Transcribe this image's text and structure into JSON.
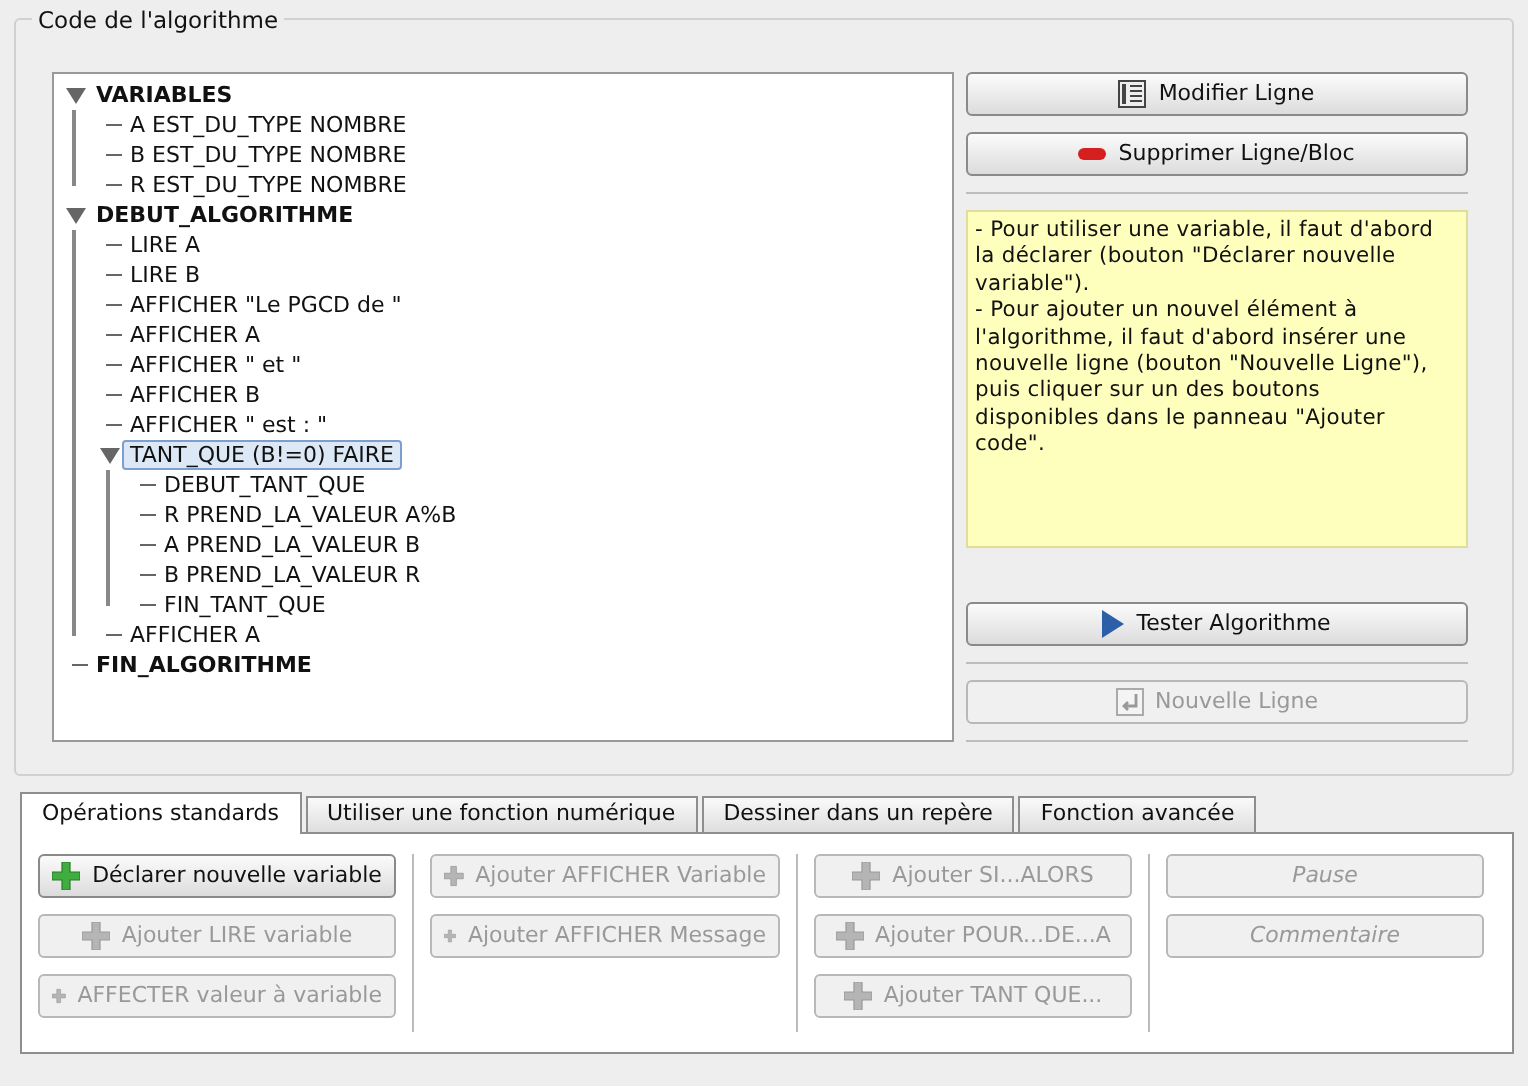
{
  "code_panel": {
    "title": "Code de l'algorithme",
    "tree": [
      {
        "text": "VARIABLES",
        "bold": true,
        "expanded": true,
        "selected": false,
        "children": [
          {
            "text": "A EST_DU_TYPE NOMBRE",
            "bold": false,
            "selected": false
          },
          {
            "text": "B EST_DU_TYPE NOMBRE",
            "bold": false,
            "selected": false
          },
          {
            "text": "R EST_DU_TYPE NOMBRE",
            "bold": false,
            "selected": false
          }
        ]
      },
      {
        "text": "DEBUT_ALGORITHME",
        "bold": true,
        "expanded": true,
        "selected": false,
        "children": [
          {
            "text": "LIRE A",
            "bold": false,
            "selected": false
          },
          {
            "text": "LIRE B",
            "bold": false,
            "selected": false
          },
          {
            "text": "AFFICHER \"Le PGCD de \"",
            "bold": false,
            "selected": false
          },
          {
            "text": "AFFICHER A",
            "bold": false,
            "selected": false
          },
          {
            "text": "AFFICHER \" et \"",
            "bold": false,
            "selected": false
          },
          {
            "text": "AFFICHER B",
            "bold": false,
            "selected": false
          },
          {
            "text": "AFFICHER \" est : \"",
            "bold": false,
            "selected": false
          },
          {
            "text": "TANT_QUE (B!=0) FAIRE",
            "bold": false,
            "expanded": true,
            "selected": true,
            "children": [
              {
                "text": "DEBUT_TANT_QUE",
                "bold": false,
                "selected": false
              },
              {
                "text": "R PREND_LA_VALEUR A%B",
                "bold": false,
                "selected": false
              },
              {
                "text": "A PREND_LA_VALEUR B",
                "bold": false,
                "selected": false
              },
              {
                "text": "B PREND_LA_VALEUR R",
                "bold": false,
                "selected": false
              },
              {
                "text": "FIN_TANT_QUE",
                "bold": false,
                "selected": false
              }
            ]
          },
          {
            "text": "AFFICHER A",
            "bold": false,
            "selected": false
          }
        ]
      },
      {
        "text": "FIN_ALGORITHME",
        "bold": true,
        "selected": false
      }
    ],
    "top_buttons": [
      {
        "label": "Modifier Ligne",
        "kind": "list",
        "disabled": false
      },
      {
        "label": "Supprimer Ligne/Bloc",
        "kind": "minus",
        "disabled": false
      }
    ],
    "help": "- Pour utiliser une variable, il faut d'abord la déclarer (bouton \"Déclarer nouvelle variable\").\n- Pour ajouter un nouvel élément à l'algorithme, il faut d'abord insérer une nouvelle ligne (bouton \"Nouvelle Ligne\"), puis cliquer sur un des boutons disponibles dans le panneau \"Ajouter code\".",
    "bottom_buttons": [
      {
        "label": "Tester Algorithme",
        "kind": "play",
        "disabled": false
      },
      {
        "label": "Nouvelle Ligne",
        "kind": "return",
        "disabled": true
      }
    ]
  },
  "tabs": [
    {
      "label": "Opérations standards",
      "selected": true
    },
    {
      "label": "Utiliser une fonction numérique",
      "selected": false
    },
    {
      "label": "Dessiner dans un repère",
      "selected": false
    },
    {
      "label": "Fonction avancée",
      "selected": false
    }
  ],
  "button_columns": [
    [
      {
        "label": "Déclarer nouvelle variable",
        "kind": "plus",
        "disabled": false
      },
      {
        "label": "Ajouter LIRE variable",
        "kind": "plus",
        "disabled": true
      },
      {
        "label": "AFFECTER valeur à variable",
        "kind": "plus",
        "disabled": true
      }
    ],
    [
      {
        "label": "Ajouter AFFICHER Variable",
        "kind": "plus",
        "disabled": true
      },
      {
        "label": "Ajouter AFFICHER Message",
        "kind": "plus",
        "disabled": true
      }
    ],
    [
      {
        "label": "Ajouter SI...ALORS",
        "kind": "plus",
        "disabled": true
      },
      {
        "label": "Ajouter POUR...DE...A",
        "kind": "plus",
        "disabled": true
      },
      {
        "label": "Ajouter TANT QUE...",
        "kind": "plus",
        "disabled": true
      }
    ],
    [
      {
        "label": "Pause",
        "kind": "plain",
        "disabled": true
      },
      {
        "label": "Commentaire",
        "kind": "plain",
        "disabled": true
      }
    ]
  ]
}
